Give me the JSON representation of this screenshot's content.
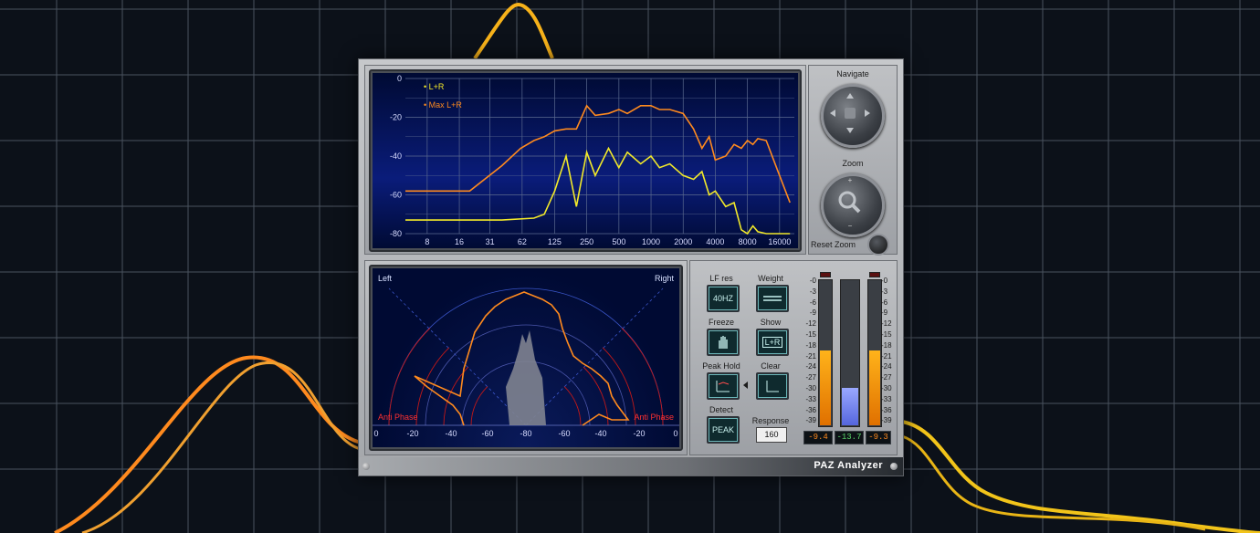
{
  "colors": {
    "orange": "#ff8a1e",
    "yellow": "#f2e92a",
    "screen": "#000a33",
    "grid": "#5b6a8f"
  },
  "spectrum": {
    "y_ticks": [
      "0",
      "-20",
      "-40",
      "-60",
      "-80"
    ],
    "x_ticks": [
      "8",
      "16",
      "31",
      "62",
      "125",
      "250",
      "500",
      "1000",
      "2000",
      "4000",
      "8000",
      "16000"
    ],
    "legend": [
      {
        "name": "L+R",
        "color": "#f2e92a"
      },
      {
        "name": "Max L+R",
        "color": "#ff8a1e"
      }
    ]
  },
  "navigate": {
    "label": "Navigate"
  },
  "zoom": {
    "label": "Zoom"
  },
  "reset_zoom": {
    "label": "Reset Zoom"
  },
  "stereo": {
    "left_label": "Left",
    "right_label": "Right",
    "anti_phase_left": "Anti Phase",
    "anti_phase_right": "Anti Phase",
    "x_ticks": [
      "0",
      "-20",
      "-40",
      "-60",
      "-80",
      "-60",
      "-40",
      "-20",
      "0"
    ]
  },
  "controls": {
    "lf_res": {
      "label": "LF res",
      "value": "40HZ"
    },
    "weight": {
      "label": "Weight"
    },
    "freeze": {
      "label": "Freeze"
    },
    "show": {
      "label": "Show",
      "value": "L+R"
    },
    "peak_hold": {
      "label": "Peak Hold"
    },
    "clear": {
      "label": "Clear"
    },
    "detect": {
      "label": "Detect",
      "value": "PEAK"
    },
    "response": {
      "label": "Response",
      "value": "160"
    }
  },
  "meters": {
    "scale": [
      "-0",
      "-3",
      "-6",
      "-9",
      "-12",
      "-15",
      "-18",
      "-21",
      "-24",
      "-27",
      "-30",
      "-33",
      "-36",
      "-39"
    ],
    "left": {
      "value": "-9.4",
      "level": 0.52
    },
    "center": {
      "value": "-13.7",
      "level": 0.26
    },
    "right": {
      "value": "-9.3",
      "level": 0.52
    }
  },
  "brand": {
    "name": "PAZ Analyzer"
  },
  "chart_data": {
    "type": "line",
    "x_scale": "log",
    "xlim": [
      5,
      22000
    ],
    "ylim": [
      -80,
      0
    ],
    "series": [
      {
        "name": "L+R",
        "color": "#f2e92a",
        "x": [
          5,
          20,
          40,
          80,
          100,
          125,
          160,
          200,
          250,
          300,
          400,
          500,
          600,
          800,
          1000,
          1200,
          1500,
          2000,
          2500,
          3000,
          3500,
          4000,
          5000,
          6000,
          7000,
          8000,
          9000,
          10000,
          12000,
          16000,
          20000
        ],
        "y": [
          -73,
          -73,
          -73,
          -72,
          -70,
          -58,
          -40,
          -66,
          -38,
          -50,
          -36,
          -46,
          -38,
          -44,
          -40,
          -46,
          -44,
          -50,
          -52,
          -48,
          -60,
          -58,
          -66,
          -64,
          -78,
          -80,
          -76,
          -79,
          -80,
          -80,
          -80
        ]
      },
      {
        "name": "Max L+R",
        "color": "#ff8a1e",
        "x": [
          5,
          20,
          40,
          60,
          80,
          100,
          125,
          160,
          200,
          250,
          300,
          400,
          500,
          600,
          800,
          1000,
          1200,
          1500,
          2000,
          2500,
          3000,
          3500,
          4000,
          5000,
          6000,
          7000,
          8000,
          9000,
          10000,
          12000,
          16000,
          20000
        ],
        "y": [
          -58,
          -58,
          -45,
          -36,
          -32,
          -30,
          -27,
          -26,
          -26,
          -14,
          -19,
          -18,
          -16,
          -18,
          -14,
          -14,
          -16,
          -16,
          -18,
          -26,
          -36,
          -30,
          -42,
          -40,
          -34,
          -36,
          -32,
          -34,
          -31,
          -32,
          -50,
          -64
        ]
      }
    ]
  }
}
